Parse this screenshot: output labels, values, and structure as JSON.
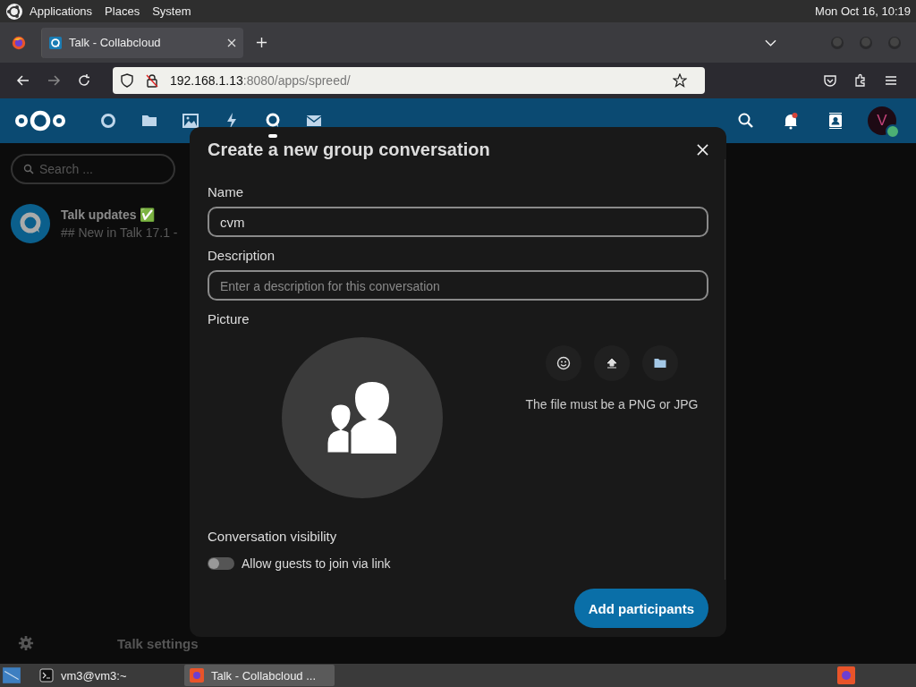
{
  "top_panel": {
    "menus": [
      "Applications",
      "Places",
      "System"
    ],
    "clock": "Mon Oct 16, 10:19"
  },
  "browser": {
    "tabs": [
      {
        "title": "Talk - Collabcloud",
        "selected": true
      }
    ],
    "address": {
      "host": "192.168.1.13",
      "rest": ":8080/apps/spreed/"
    }
  },
  "header": {
    "apps": [
      {
        "kind": "dashboard",
        "selected": false
      },
      {
        "kind": "files",
        "selected": false
      },
      {
        "kind": "photos",
        "selected": false
      },
      {
        "kind": "activity",
        "selected": false
      },
      {
        "kind": "talk",
        "selected": true
      },
      {
        "kind": "mail",
        "selected": false
      }
    ],
    "avatar": "V"
  },
  "sidebar": {
    "search": {
      "placeholder": "Search ..."
    },
    "conversations": [
      {
        "name": "Talk updates ✅",
        "preview": "## New in Talk 17.1 -"
      }
    ],
    "settings": "Talk settings"
  },
  "dialog": {
    "title": "Create a new group conversation",
    "name": {
      "label": "Name",
      "value": "cvm"
    },
    "description": {
      "label": "Description",
      "placeholder": "Enter a description for this conversation"
    },
    "picture": {
      "label": "Picture",
      "buttons": [
        {
          "kind": "emoji"
        },
        {
          "kind": "upload"
        },
        {
          "kind": "folder"
        }
      ],
      "hint": "The file must be a PNG or JPG"
    },
    "visibility": {
      "label": "Conversation visibility",
      "toggles": [
        {
          "label": "Allow guests to join via link",
          "on": false
        }
      ]
    },
    "primary_button": "Add participants"
  },
  "taskbar": {
    "windows": [
      {
        "kind": "terminal",
        "title": "vm3@vm3:~",
        "selected": false
      },
      {
        "kind": "browser",
        "title": "Talk - Collabcloud ...",
        "selected": true
      }
    ]
  }
}
